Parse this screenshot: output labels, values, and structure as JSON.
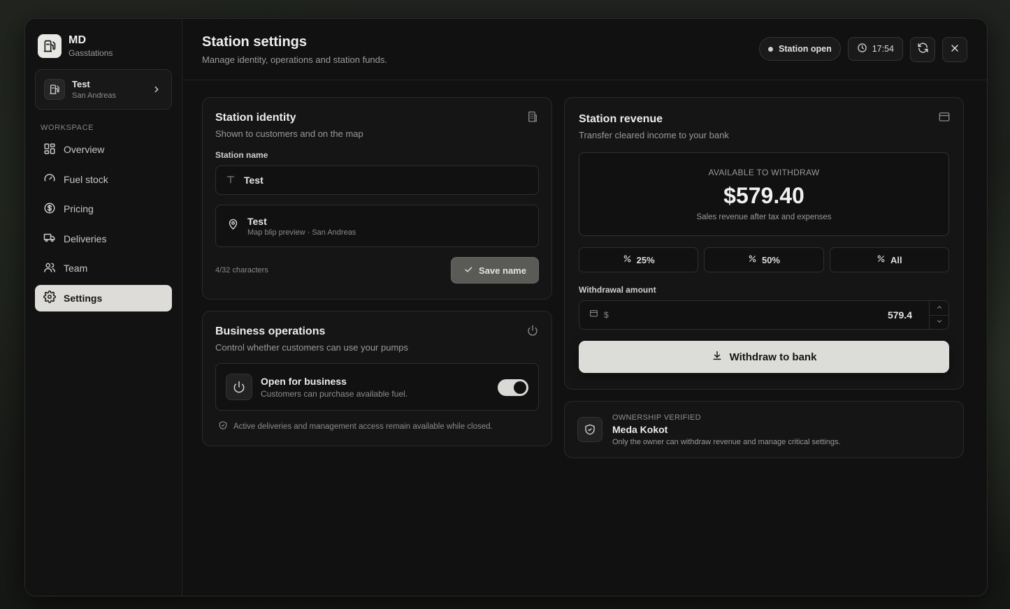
{
  "brand": {
    "title": "MD",
    "subtitle": "Gasstations",
    "logo_icon": "fuel-pump-icon"
  },
  "station_card": {
    "name": "Test",
    "region": "San Andreas"
  },
  "sidebar": {
    "section_label": "WORKSPACE",
    "items": [
      {
        "label": "Overview",
        "icon": "grid-icon"
      },
      {
        "label": "Fuel stock",
        "icon": "gauge-icon"
      },
      {
        "label": "Pricing",
        "icon": "dollar-icon"
      },
      {
        "label": "Deliveries",
        "icon": "truck-icon"
      },
      {
        "label": "Team",
        "icon": "users-icon"
      },
      {
        "label": "Settings",
        "icon": "gear-icon",
        "active": true
      }
    ]
  },
  "header": {
    "title": "Station settings",
    "subtitle": "Manage identity, operations and station funds.",
    "status": "Station open",
    "time": "17:54"
  },
  "identity": {
    "title": "Station identity",
    "subtitle": "Shown to customers and on the map",
    "field_label": "Station name",
    "name_value": "Test",
    "preview_name": "Test",
    "preview_sub": "Map blip preview · San Andreas",
    "char_count": "4/32 characters",
    "save_label": "Save name"
  },
  "operations": {
    "title": "Business operations",
    "subtitle": "Control whether customers can use your pumps",
    "toggle_title": "Open for business",
    "toggle_sub": "Customers can purchase available fuel.",
    "toggle_on": true,
    "note": "Active deliveries and management access remain available while closed."
  },
  "revenue": {
    "title": "Station revenue",
    "subtitle": "Transfer cleared income to your bank",
    "available_label": "AVAILABLE TO WITHDRAW",
    "available_amount": "$579.40",
    "available_sub": "Sales revenue after tax and expenses",
    "percent_buttons": [
      "25%",
      "50%",
      "All"
    ],
    "amount_label": "Withdrawal amount",
    "currency": "$",
    "amount_value": "579.4",
    "withdraw_label": "Withdraw to bank"
  },
  "ownership": {
    "label": "OWNERSHIP VERIFIED",
    "name": "Meda Kokot",
    "sub": "Only the owner can withdraw revenue and manage critical settings."
  },
  "colors": {
    "accent": "#dcdcd8",
    "background": "#111111",
    "card": "#151515"
  }
}
